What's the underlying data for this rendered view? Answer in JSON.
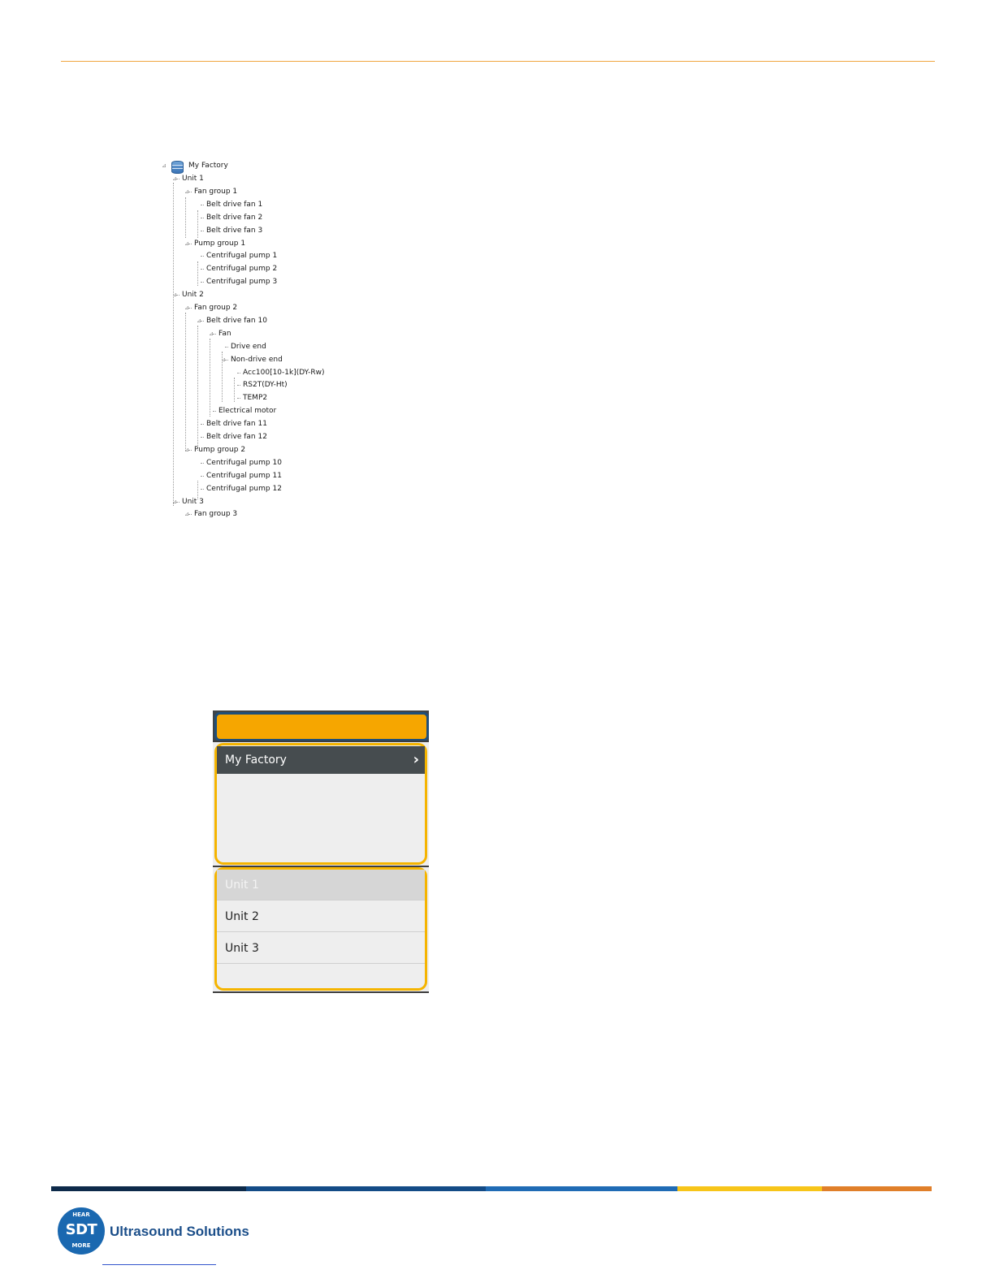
{
  "tree": {
    "root_label": "My Factory",
    "nodes": [
      {
        "label": "Unit 1",
        "depth": 1,
        "expander": true
      },
      {
        "label": "Fan group 1",
        "depth": 2,
        "expander": true
      },
      {
        "label": "Belt drive fan 1",
        "depth": 3,
        "expander": false
      },
      {
        "label": "Belt drive fan 2",
        "depth": 3,
        "expander": false
      },
      {
        "label": "Belt drive fan 3",
        "depth": 3,
        "expander": false
      },
      {
        "label": "Pump group 1",
        "depth": 2,
        "expander": true
      },
      {
        "label": "Centrifugal pump 1",
        "depth": 3,
        "expander": false
      },
      {
        "label": "Centrifugal pump 2",
        "depth": 3,
        "expander": false
      },
      {
        "label": "Centrifugal pump 3",
        "depth": 3,
        "expander": false
      },
      {
        "label": "Unit 2",
        "depth": 1,
        "expander": true
      },
      {
        "label": "Fan group 2",
        "depth": 2,
        "expander": true
      },
      {
        "label": "Belt drive fan 10",
        "depth": 3,
        "expander": true
      },
      {
        "label": "Fan",
        "depth": 4,
        "expander": true
      },
      {
        "label": "Drive end",
        "depth": 5,
        "expander": false
      },
      {
        "label": "Non-drive end",
        "depth": 5,
        "expander": true
      },
      {
        "label": "Acc100[10-1k](DY-Rw)",
        "depth": 6,
        "expander": false
      },
      {
        "label": "RS2T(DY-Ht)",
        "depth": 6,
        "expander": false
      },
      {
        "label": "TEMP2",
        "depth": 6,
        "expander": false
      },
      {
        "label": "Electrical motor",
        "depth": 4,
        "expander": false
      },
      {
        "label": "Belt drive fan 11",
        "depth": 3,
        "expander": false
      },
      {
        "label": "Belt drive fan 12",
        "depth": 3,
        "expander": false
      },
      {
        "label": "Pump group 2",
        "depth": 2,
        "expander": true
      },
      {
        "label": "Centrifugal pump 10",
        "depth": 3,
        "expander": false
      },
      {
        "label": "Centrifugal pump 11",
        "depth": 3,
        "expander": false
      },
      {
        "label": "Centrifugal pump 12",
        "depth": 3,
        "expander": false
      },
      {
        "label": "Unit 3",
        "depth": 1,
        "expander": true
      },
      {
        "label": "Fan group 3",
        "depth": 2,
        "expander": true
      }
    ]
  },
  "panel": {
    "factory_label": "My Factory",
    "units": [
      "Unit 1",
      "Unit 2",
      "Unit 3"
    ],
    "selected_unit": "Unit 1"
  },
  "footer": {
    "brand": "Ultrasound Solutions",
    "logo_main": "SDT",
    "logo_top": "HEAR",
    "logo_bottom": "MORE",
    "bar_colors": [
      "#0d2a4a",
      "#134b86",
      "#1f6bb5",
      "#f7c519",
      "#e07f2a"
    ]
  },
  "colors": {
    "rule": "#f0a640",
    "panel_header": "#f6a600",
    "highlight_box": "#f5b400"
  }
}
